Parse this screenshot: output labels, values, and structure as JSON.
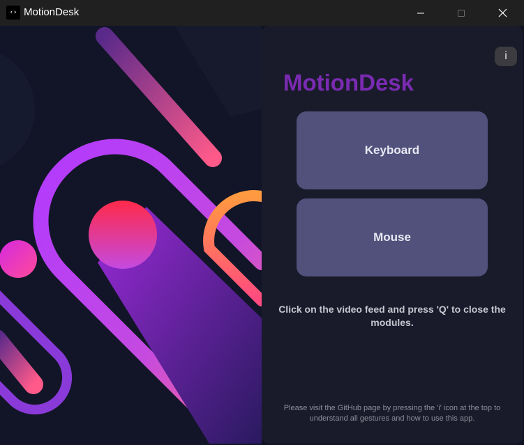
{
  "window": {
    "title": "MotionDesk",
    "app_icon_glyph": "‹›",
    "controls": [
      "minimize-icon",
      "maximize-icon",
      "close-icon"
    ]
  },
  "panel": {
    "info_label": "i",
    "title": "MotionDesk",
    "buttons": {
      "keyboard": "Keyboard",
      "mouse": "Mouse"
    },
    "instruction": "Click on the video feed and press 'Q' to close the modules.",
    "footer_note": "Please visit the GitHub page by pressing the 'i' icon at the top to understand all gestures and how to use this app."
  },
  "colors": {
    "accent": "#7a2bb2",
    "button_bg": "#52517c",
    "panel_bg": "#191b2b",
    "background": "#0f1220"
  }
}
